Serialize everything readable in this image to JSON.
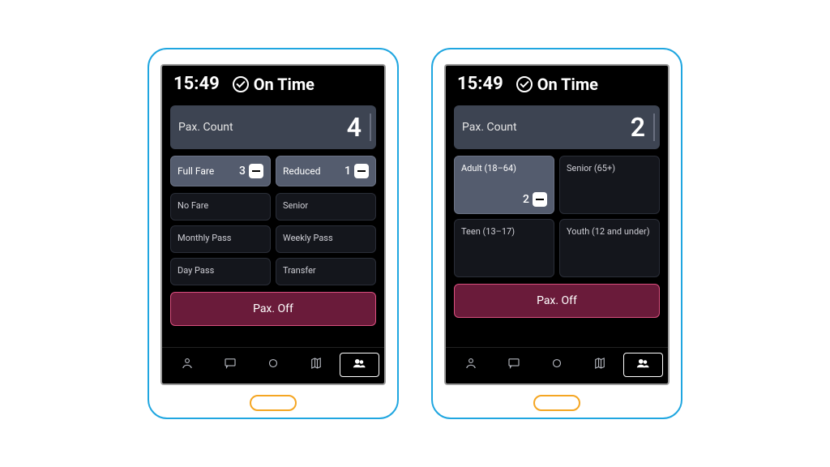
{
  "devices": [
    {
      "id": "dev1",
      "clock": "15:49",
      "status": {
        "text": "On Time"
      },
      "pax": {
        "label": "Pax. Count",
        "value": "4"
      },
      "tile_layout": "compact",
      "tiles_row1": [
        {
          "label": "Full Fare",
          "count": "3",
          "active": true,
          "has_minus": true
        },
        {
          "label": "Reduced",
          "count": "1",
          "active": true,
          "has_minus": true
        }
      ],
      "tiles_rest": [
        {
          "label": "No Fare"
        },
        {
          "label": "Senior"
        },
        {
          "label": "Monthly Pass"
        },
        {
          "label": "Weekly Pass"
        },
        {
          "label": "Day Pass"
        },
        {
          "label": "Transfer"
        }
      ],
      "pax_off": "Pax. Off"
    },
    {
      "id": "dev2",
      "clock": "15:49",
      "status": {
        "text": "On Time"
      },
      "pax": {
        "label": "Pax. Count",
        "value": "2"
      },
      "tile_layout": "tall",
      "tiles_tall": [
        {
          "label": "Adult (18–64)",
          "count": "2",
          "active": true,
          "has_minus": true
        },
        {
          "label": "Senior (65+)"
        },
        {
          "label": "Teen (13–17)"
        },
        {
          "label": "Youth (12 and under)"
        }
      ],
      "pax_off": "Pax. Off"
    }
  ],
  "nav_icons": [
    "person-icon",
    "chat-icon",
    "record-icon",
    "map-icon",
    "people-icon"
  ],
  "nav_selected_index": 4
}
